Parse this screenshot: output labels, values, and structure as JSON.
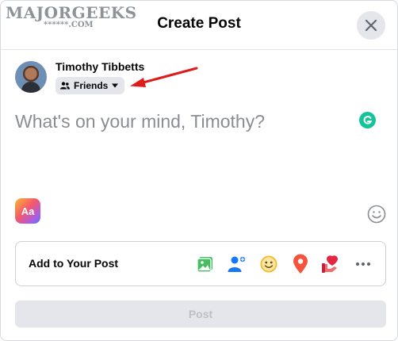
{
  "watermark": {
    "main": "MAJORGEEKS",
    "sub": "******.COM"
  },
  "header": {
    "title": "Create Post"
  },
  "user": {
    "name": "Timothy Tibbetts",
    "audience": "Friends"
  },
  "composer": {
    "placeholder": "What's on your mind, Timothy?"
  },
  "background_picker": {
    "label": "Aa"
  },
  "add_to_post": {
    "label": "Add to Your Post",
    "icons": [
      "photo-video-icon",
      "tag-people-icon",
      "feeling-activity-icon",
      "check-in-icon",
      "host-qa-icon",
      "more-icon"
    ]
  },
  "post_button": {
    "label": "Post"
  },
  "colors": {
    "photo": "#45bd62",
    "tag": "#1877f2",
    "feeling": "#f7b928",
    "checkin": "#f5533d",
    "host": "#e42645",
    "arrow": "#e01b1b",
    "grammarly": "#15c39a"
  }
}
